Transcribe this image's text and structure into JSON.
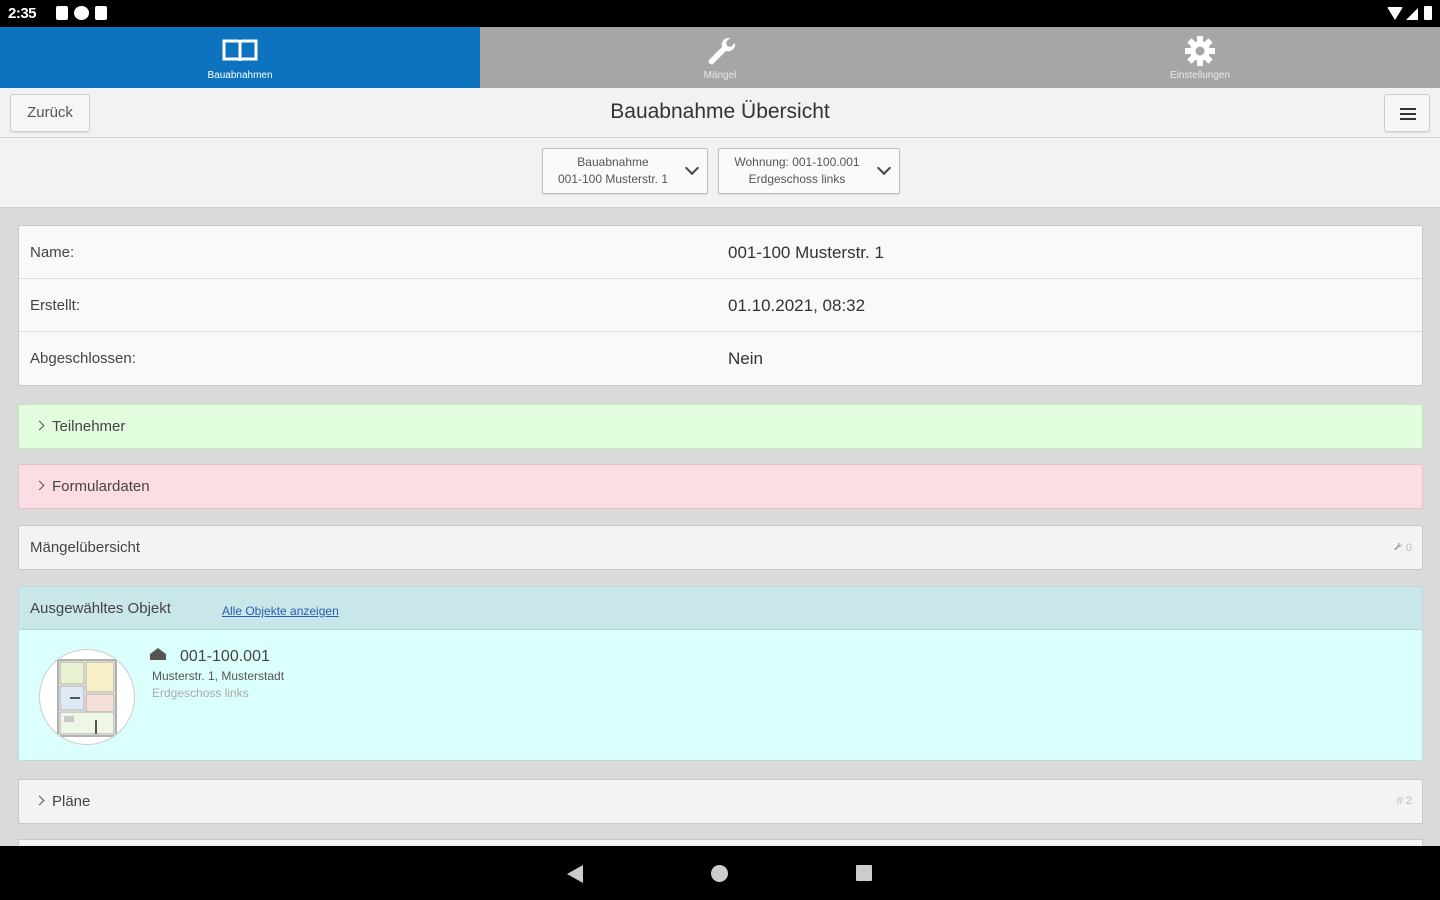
{
  "statusbar": {
    "time": "2:35"
  },
  "tabs": [
    {
      "label": "Bauabnahmen",
      "icon": "book-icon",
      "active": true
    },
    {
      "label": "Mängel",
      "icon": "wrench-icon",
      "active": false
    },
    {
      "label": "Einstellungen",
      "icon": "gear-icon",
      "active": false
    }
  ],
  "header": {
    "back_label": "Zurück",
    "title": "Bauabnahme Übersicht",
    "menu_icon": "hamburger-icon"
  },
  "selectors": [
    {
      "line1": "Bauabnahme",
      "line2": "001-100 Musterstr. 1"
    },
    {
      "line1": "Wohnung: 001-100.001",
      "line2": "Erdgeschoss links"
    }
  ],
  "info": [
    {
      "key": "Name:",
      "value": "001-100 Musterstr. 1"
    },
    {
      "key": "Erstellt:",
      "value": "01.10.2021, 08:32"
    },
    {
      "key": "Abgeschlossen:",
      "value": "Nein"
    }
  ],
  "sections": {
    "teilnehmer": "Teilnehmer",
    "formulardaten": "Formulardaten",
    "maengel": {
      "label": "Mängelübersicht",
      "count": "0"
    },
    "plaene": {
      "label": "Pläne",
      "count": "2"
    }
  },
  "object": {
    "header": "Ausgewähltes Objekt",
    "link": "Alle Objekte anzeigen",
    "number": "001-100.001",
    "address": "Musterstr. 1, Musterstadt",
    "floor": "Erdgeschoss links"
  },
  "colors": {
    "tab_active": "#0e73bf",
    "teilnehmer_bg": "#e1fddd",
    "formular_bg": "#fddde4",
    "object_bg": "#dbfffd"
  }
}
